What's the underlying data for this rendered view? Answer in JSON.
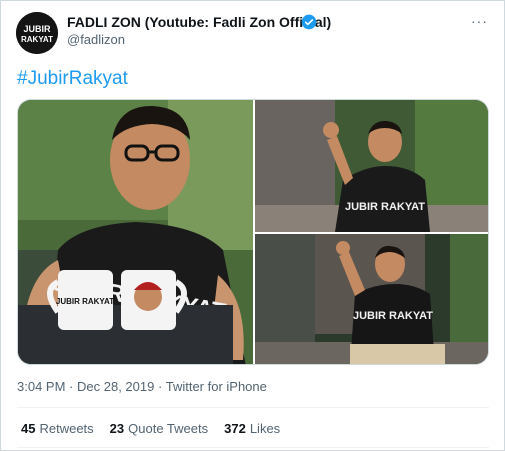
{
  "tweet": {
    "display_name": "FADLI ZON (Youtube: Fadli Zon Official)",
    "handle": "@fadlizon",
    "avatar_text": "JUBIR RAKYAT",
    "more_label": "···",
    "hashtag": "#JubirRakyat",
    "time": "3:04 PM",
    "date": "Dec 28, 2019",
    "separator": "·",
    "source": "Twitter for iPhone",
    "verified": true
  },
  "stats": {
    "retweets": {
      "count": "45",
      "label": "Retweets"
    },
    "quote_tweets": {
      "count": "23",
      "label": "Quote Tweets"
    },
    "likes": {
      "count": "372",
      "label": "Likes"
    }
  },
  "photos": [
    {
      "shirt_text": "JUBIR RAKYAT",
      "mug_text": "JUBIR RAKYAT"
    },
    {
      "shirt_text": "JUBIR RAKYAT"
    },
    {
      "shirt_text": "JUBIR RAKYAT"
    }
  ],
  "colors": {
    "accent": "#1d9bf0",
    "text": "#0f1419",
    "muted": "#536471",
    "border": "#cfd9de"
  }
}
